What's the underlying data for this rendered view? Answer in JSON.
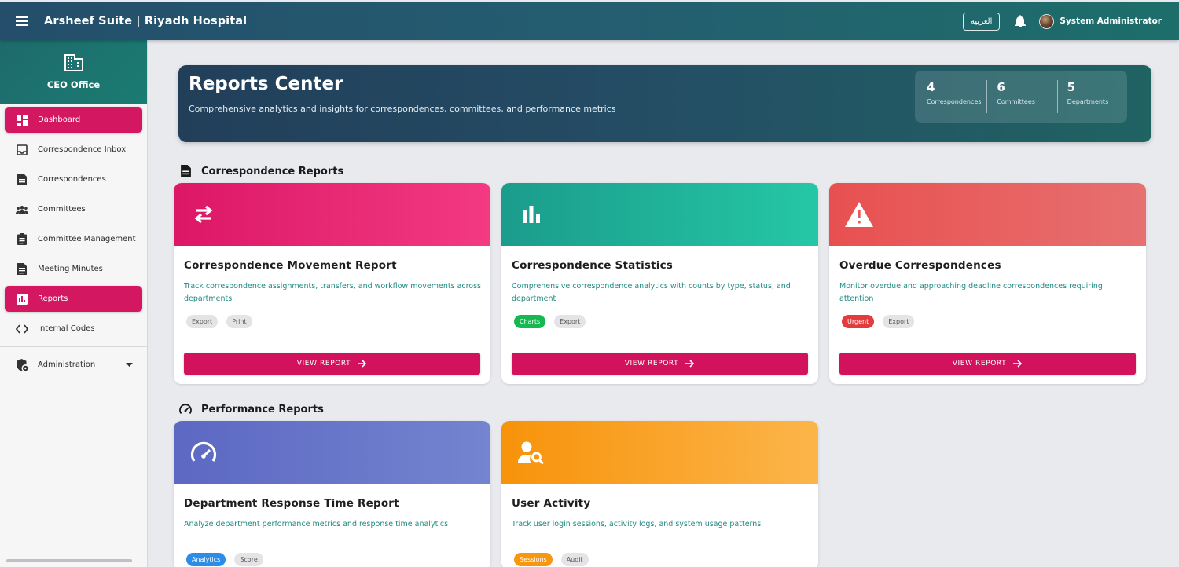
{
  "topbar": {
    "title": "Arsheef Suite | Riyadh Hospital",
    "language_button": "العربية",
    "user_name": "System Administrator"
  },
  "sidebar": {
    "org_name": "CEO Office",
    "items": [
      {
        "label": "Dashboard",
        "icon": "dashboard-icon",
        "active": true
      },
      {
        "label": "Correspondence Inbox",
        "icon": "inbox-icon",
        "active": false
      },
      {
        "label": "Correspondences",
        "icon": "document-icon",
        "active": false
      },
      {
        "label": "Committees",
        "icon": "group-icon",
        "active": false
      },
      {
        "label": "Committee Management",
        "icon": "clipboard-icon",
        "active": false
      },
      {
        "label": "Meeting Minutes",
        "icon": "notes-icon",
        "active": false
      },
      {
        "label": "Reports",
        "icon": "bar-chart-icon",
        "active": true
      },
      {
        "label": "Internal Codes",
        "icon": "code-icon",
        "active": false
      }
    ],
    "admin_label": "Administration"
  },
  "hero": {
    "title": "Reports Center",
    "subtitle": "Comprehensive analytics and insights for correspondences, committees, and performance metrics",
    "stats": [
      {
        "value": "4",
        "label": "Correspondences"
      },
      {
        "value": "6",
        "label": "Committees"
      },
      {
        "value": "5",
        "label": "Departments"
      }
    ]
  },
  "sections": {
    "correspondence_title": "Correspondence Reports",
    "performance_title": "Performance Reports"
  },
  "cards": [
    {
      "title": "Correspondence Movement Report",
      "desc": "Track correspondence assignments, transfers, and workflow movements across departments",
      "tags": [
        "Export",
        "Print"
      ],
      "button": "VIEW REPORT",
      "icon": "swap-arrows-icon",
      "color": "#e0186a"
    },
    {
      "title": "Correspondence Statistics",
      "desc": "Comprehensive correspondence analytics with counts by type, status, and department",
      "tags": [
        "Charts",
        "Export"
      ],
      "button": "VIEW REPORT",
      "icon": "bar-chart-icon",
      "color": "#1aa58f"
    },
    {
      "title": "Overdue Correspondences",
      "desc": "Monitor overdue and approaching deadline correspondences requiring attention",
      "tags": [
        "Urgent",
        "Export"
      ],
      "button": "VIEW REPORT",
      "icon": "warning-icon",
      "color": "#e85a5a"
    },
    {
      "title": "Department Response Time Report",
      "desc": "Analyze department performance metrics and response time analytics",
      "tags": [
        "Analytics",
        "Score"
      ],
      "icon": "speedometer-icon",
      "color": "#6a74c9"
    },
    {
      "title": "User Activity",
      "desc": "Track user login sessions, activity logs, and system usage patterns",
      "tags": [
        "Sessions",
        "Audit"
      ],
      "icon": "user-search-icon",
      "color": "#f7960f"
    }
  ]
}
